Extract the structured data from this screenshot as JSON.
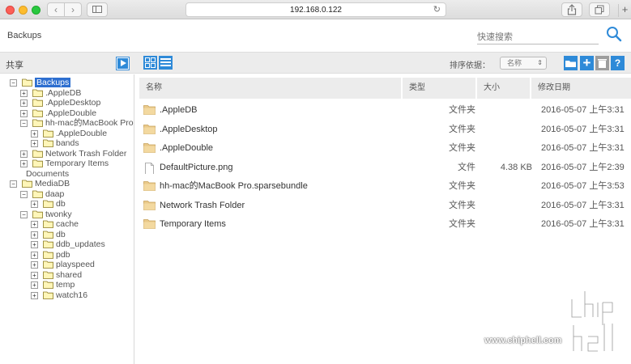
{
  "browser": {
    "url": "192.168.0.122",
    "back_icon": "chevron-left-icon",
    "forward_icon": "chevron-right-icon",
    "reload_icon": "reload-icon",
    "new_tab_label": "+"
  },
  "header": {
    "title": "Backups",
    "search_placeholder": "快速搜索"
  },
  "toolbar": {
    "share_label": "共享",
    "sort_label": "排序依据：",
    "sort_value": "名称",
    "accent_color": "#2e8ad8"
  },
  "tree": [
    {
      "label": "Backups",
      "depth": 0,
      "expanded": true,
      "selected": true
    },
    {
      "label": ".AppleDB",
      "depth": 1,
      "expanded": false
    },
    {
      "label": ".AppleDesktop",
      "depth": 1,
      "expanded": false
    },
    {
      "label": ".AppleDouble",
      "depth": 1,
      "expanded": false
    },
    {
      "label": "hh-mac的MacBook Pro.s",
      "depth": 1,
      "expanded": true
    },
    {
      "label": ".AppleDouble",
      "depth": 2,
      "expanded": false
    },
    {
      "label": "bands",
      "depth": 2,
      "expanded": false
    },
    {
      "label": "Network Trash Folder",
      "depth": 1,
      "expanded": false
    },
    {
      "label": "Temporary Items",
      "depth": 1,
      "expanded": false
    },
    {
      "label": "Documents",
      "depth": 0,
      "expanded": false,
      "no_folder": true
    },
    {
      "label": "MediaDB",
      "depth": 0,
      "expanded": true
    },
    {
      "label": "daap",
      "depth": 1,
      "expanded": true
    },
    {
      "label": "db",
      "depth": 2,
      "expanded": false
    },
    {
      "label": "twonky",
      "depth": 1,
      "expanded": true
    },
    {
      "label": "cache",
      "depth": 2,
      "expanded": false
    },
    {
      "label": "db",
      "depth": 2,
      "expanded": false
    },
    {
      "label": "ddb_updates",
      "depth": 2,
      "expanded": false
    },
    {
      "label": "pdb",
      "depth": 2,
      "expanded": false
    },
    {
      "label": "playspeed",
      "depth": 2,
      "expanded": false
    },
    {
      "label": "shared",
      "depth": 2,
      "expanded": false
    },
    {
      "label": "temp",
      "depth": 2,
      "expanded": false
    },
    {
      "label": "watch16",
      "depth": 2,
      "expanded": false
    }
  ],
  "columns": {
    "name": "名称",
    "type": "类型",
    "size": "大小",
    "date": "修改日期"
  },
  "files": [
    {
      "name": ".AppleDB",
      "type": "文件夹",
      "size": "",
      "date": "2016-05-07 上午3:31",
      "icon": "folder-icon"
    },
    {
      "name": ".AppleDesktop",
      "type": "文件夹",
      "size": "",
      "date": "2016-05-07 上午3:31",
      "icon": "folder-icon"
    },
    {
      "name": ".AppleDouble",
      "type": "文件夹",
      "size": "",
      "date": "2016-05-07 上午3:31",
      "icon": "folder-icon"
    },
    {
      "name": "DefaultPicture.png",
      "type": "文件",
      "size": "4.38 KB",
      "date": "2016-05-07 上午2:39",
      "icon": "file-icon"
    },
    {
      "name": "hh-mac的MacBook Pro.sparsebundle",
      "type": "文件夹",
      "size": "",
      "date": "2016-05-07 上午3:53",
      "icon": "folder-icon"
    },
    {
      "name": "Network Trash Folder",
      "type": "文件夹",
      "size": "",
      "date": "2016-05-07 上午3:31",
      "icon": "folder-icon"
    },
    {
      "name": "Temporary Items",
      "type": "文件夹",
      "size": "",
      "date": "2016-05-07 上午3:31",
      "icon": "folder-icon"
    }
  ],
  "watermark": {
    "text": "www.chiphell.com",
    "logo_text": "chip hell"
  }
}
